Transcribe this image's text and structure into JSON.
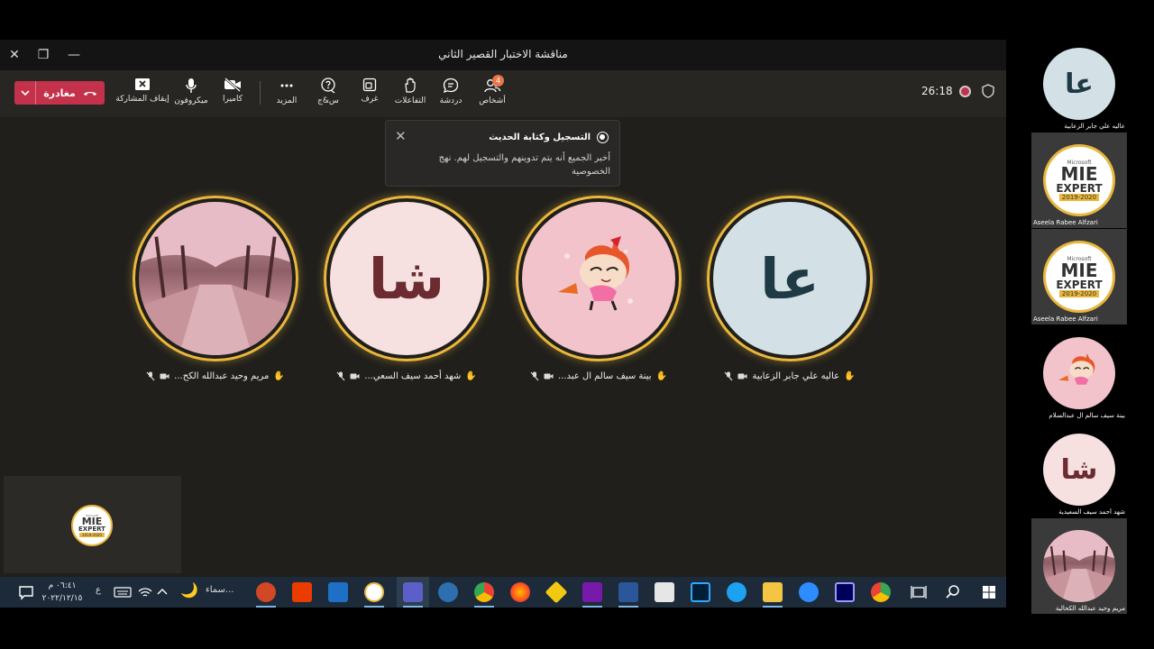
{
  "window": {
    "title": "مناقشة الاختبار القصير الثاني",
    "close": "✕",
    "restore": "❐",
    "minimize": "—"
  },
  "toolbar": {
    "leave_label": "مغادرة",
    "share_label": "إيقاف المشاركة",
    "mic_label": "ميكروفون",
    "camera_label": "كاميرا",
    "more_label": "المزيد",
    "qa_label": "س&ج",
    "rooms_label": "غرف",
    "reactions_label": "التفاعلات",
    "chat_label": "دردشة",
    "people_label": "أشخاص",
    "people_count": "4",
    "timer": "26:18"
  },
  "notification": {
    "title": "التسجيل وكتابة الحديث",
    "body": "أخبر الجميع أنه يتم تدوينهم والتسجيل لهم. نهج الخصوصية"
  },
  "participants": [
    {
      "name": "عاليه علي جابر الزعابية",
      "initials": "عا",
      "bg": "#d3e1e6",
      "fg": "#1f3a44"
    },
    {
      "name": "بينة سيف سالم ال عبد...",
      "initials": "",
      "bg": "#f2c3cb",
      "fg": "#000"
    },
    {
      "name": "شهد أحمد سيف السعي...",
      "initials": "شا",
      "bg": "#f6e1e0",
      "fg": "#6b2b30"
    },
    {
      "name": "مريم وحيد عبدالله الكح...",
      "initials": "",
      "bg": "#b88a8f",
      "fg": "#000"
    }
  ],
  "self_view": {
    "m1": "Microsoft",
    "m2": "MIE",
    "m3": "EXPERT",
    "m4": "2019-2020"
  },
  "gallery": [
    {
      "name": "عاليه علي جابر الزعابية",
      "initials": "عا"
    },
    {
      "name": "Aseela Rabee Alfzari",
      "m1": "Microsoft",
      "m2": "MIE",
      "m3": "EXPERT",
      "m4": "2019-2020"
    },
    {
      "name": "Aseela Rabee Alfzari",
      "m1": "Microsoft",
      "m2": "MIE",
      "m3": "EXPERT",
      "m4": "2019-2020"
    },
    {
      "name": "بينة سيف سالم ال عبدالسلام"
    },
    {
      "name": "شهد أحمد سيف السعيدية",
      "initials": "شا"
    },
    {
      "name": "مريم وحيد عبدالله الكحالية"
    }
  ],
  "taskbar": {
    "time": "٠٦:٤١ م",
    "date": "٢٠٢٢/١٢/١٥",
    "lang": "ع",
    "weather": "سماء..."
  },
  "colors": {
    "accent": "#e8b73c",
    "leave": "#c4314b",
    "badge": "#e97548"
  }
}
